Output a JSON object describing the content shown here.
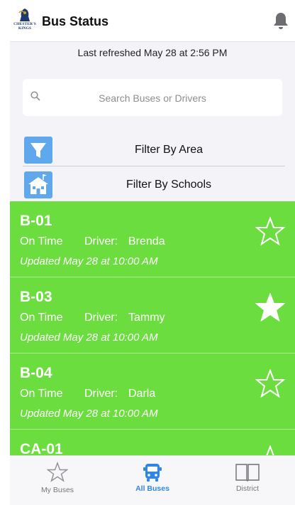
{
  "header": {
    "logo_text": "CHESTER'S KINGS",
    "title": "Bus Status",
    "notification_icon": "bell-icon"
  },
  "refresh_text": "Last refreshed May 28 at 2:56 PM",
  "search": {
    "placeholder": "Search Buses or Drivers",
    "value": "",
    "icon": "search-icon"
  },
  "filters": [
    {
      "label": "Filter By Area",
      "icon": "funnel-icon"
    },
    {
      "label": "Filter By Schools",
      "icon": "school-building-icon"
    }
  ],
  "buses": [
    {
      "id": "B-01",
      "status": "On Time",
      "driver_label": "Driver:",
      "driver": "Brenda",
      "updated": "Updated May 28 at 10:00 AM",
      "favorite": false
    },
    {
      "id": "B-03",
      "status": "On Time",
      "driver_label": "Driver:",
      "driver": "Tammy",
      "updated": "Updated May 28 at 10:00 AM",
      "favorite": true
    },
    {
      "id": "B-04",
      "status": "On Time",
      "driver_label": "Driver:",
      "driver": "Darla",
      "updated": "Updated May 28 at 10:00 AM",
      "favorite": false
    },
    {
      "id": "CA-01",
      "status": "",
      "driver_label": "",
      "driver": "",
      "updated": "",
      "favorite": false
    }
  ],
  "tabs": [
    {
      "label": "My Buses",
      "icon": "star-outline-icon",
      "active": false
    },
    {
      "label": "All Buses",
      "icon": "bus-icon",
      "active": true
    },
    {
      "label": "District",
      "icon": "open-book-icon",
      "active": false
    }
  ],
  "colors": {
    "card_green": "#6cdd3e",
    "accent_blue": "#2f86e8",
    "filter_icon_blue": "#5fa8ee",
    "background": "#f4f3f8"
  }
}
